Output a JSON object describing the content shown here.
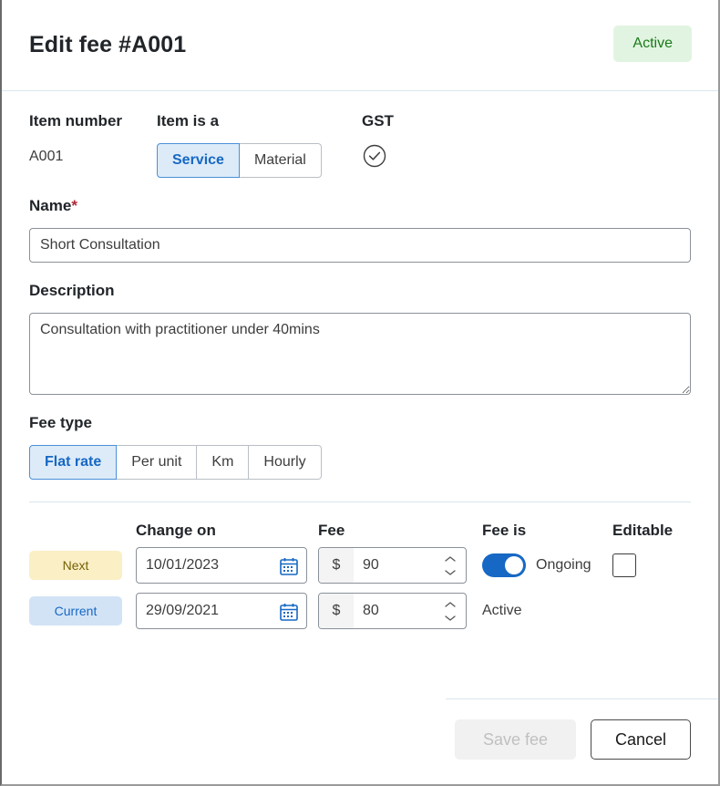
{
  "header": {
    "title": "Edit fee #A001",
    "status": "Active"
  },
  "form": {
    "item_number_label": "Item number",
    "item_number_value": "A001",
    "item_is_a_label": "Item is a",
    "item_is_a_options": [
      "Service",
      "Material"
    ],
    "item_is_a_selected": "Service",
    "gst_label": "GST",
    "gst_icon": "check-circle-icon",
    "name_label": "Name",
    "name_required_marker": "*",
    "name_value": "Short Consultation",
    "name_placeholder": "",
    "description_label": "Description",
    "description_value": "Consultation with practitioner under 40mins",
    "description_placeholder": "",
    "fee_type_label": "Fee type",
    "fee_type_options": [
      "Flat rate",
      "Per unit",
      "Km",
      "Hourly"
    ],
    "fee_type_selected": "Flat rate"
  },
  "fee_schedule": {
    "columns": {
      "tag": "",
      "change_on": "Change on",
      "fee": "Fee",
      "fee_is": "Fee is",
      "editable": "Editable"
    },
    "rows": [
      {
        "tag": "Next",
        "change_on": "10/01/2023",
        "currency_symbol": "$",
        "fee": "90",
        "fee_is": "Ongoing",
        "toggle_on": true,
        "editable_checked": false,
        "has_toggle": true,
        "has_checkbox": true
      },
      {
        "tag": "Current",
        "change_on": "29/09/2021",
        "currency_symbol": "$",
        "fee": "80",
        "fee_is": "Active",
        "toggle_on": false,
        "editable_checked": false,
        "has_toggle": false,
        "has_checkbox": false
      }
    ]
  },
  "footer": {
    "save_label": "Save fee",
    "cancel_label": "Cancel",
    "save_disabled": true
  },
  "colors": {
    "accent_blue": "#1668c4",
    "status_green_bg": "#e1f4e1",
    "status_green_text": "#1a7a1a",
    "tag_next_bg": "#fbefc5",
    "tag_next_text": "#756006",
    "tag_current_bg": "#d3e3f6",
    "tag_current_text": "#1668c4",
    "required_red": "#b02a37",
    "divider": "#d8e7ec"
  }
}
